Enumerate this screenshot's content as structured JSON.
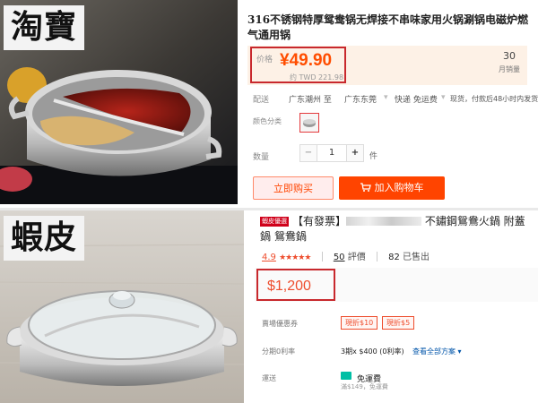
{
  "taobao": {
    "badge": "淘寶",
    "title": "316不锈钢特厚鸳鸯锅无焊接不串味家用火锅涮锅电磁炉燃气通用锅",
    "price_label": "价格",
    "price": "¥49.90",
    "price_converted": "约 TWD 221.98",
    "monthly_sales_count": "30",
    "monthly_sales_label": "月销量",
    "shipping_label": "配送",
    "ship_from": "广东潮州 至",
    "ship_to": "广东东莞",
    "ship_method": "快递 免运费",
    "ship_note": "现货，付款后48小时内发货",
    "color_label": "颜色分类",
    "quantity_label": "数量",
    "quantity_value": "1",
    "quantity_minus": "−",
    "quantity_plus": "+",
    "quantity_unit": "件",
    "buy_now_label": "立即购买",
    "add_to_cart_label": "加入购物车",
    "colors": {
      "price": "#ff4d00",
      "cart": "#ff4400",
      "highlight": "#c8282d"
    }
  },
  "shopee": {
    "badge": "蝦皮",
    "mall_tag": "蝦皮優選",
    "title_prefix": "【有發票】",
    "title_visible": "不鏽鋼鴛鴦火鍋 附蓋",
    "title_line2": "鍋 鴛鴦鍋",
    "rating_value": "4.9",
    "rating_stars": "★★★★★",
    "reviews_count": "50",
    "reviews_label": "評價",
    "sold_count": "82",
    "sold_label": "已售出",
    "price": "$1,200",
    "shop_discount_label": "賣場優惠券",
    "coupon_1": "現折$10",
    "coupon_2": "現折$5",
    "installment_label": "分期0利率",
    "installment_value": "3期x $400 (0利率)",
    "installment_link": "查看全部方案",
    "shipping_label": "運送",
    "shipping_value": "免運費",
    "shipping_sub": "滿$149，免運費",
    "colors": {
      "price": "#ee4d2d",
      "highlight": "#c8282d",
      "free_ship": "#00bfa5"
    }
  }
}
